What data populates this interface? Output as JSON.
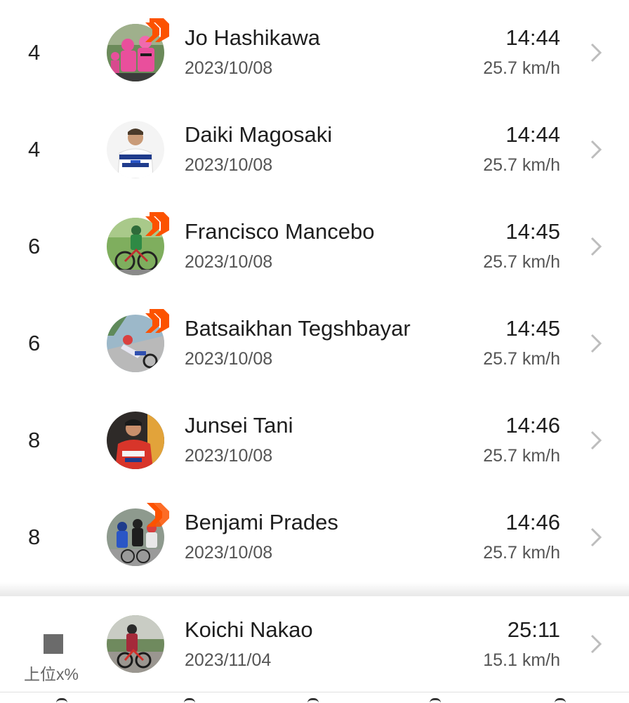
{
  "leaderboard": {
    "rows": [
      {
        "rank": "4",
        "name": "Jo Hashikawa",
        "date": "2023/10/08",
        "time": "14:44",
        "speed": "25.7 km/h",
        "badge": "subscriber-single",
        "avatar": "pink-team-rider"
      },
      {
        "rank": "4",
        "name": "Daiki Magosaki",
        "date": "2023/10/08",
        "time": "14:44",
        "speed": "25.7 km/h",
        "badge": "none",
        "avatar": "white-jersey-portrait"
      },
      {
        "rank": "6",
        "name": "Francisco Mancebo",
        "date": "2023/10/08",
        "time": "14:45",
        "speed": "25.7 km/h",
        "badge": "subscriber-single",
        "avatar": "green-road-rider"
      },
      {
        "rank": "6",
        "name": "Batsaikhan Tegshbayar",
        "date": "2023/10/08",
        "time": "14:45",
        "speed": "25.7 km/h",
        "badge": "subscriber-single",
        "avatar": "rider-in-turn"
      },
      {
        "rank": "8",
        "name": "Junsei Tani",
        "date": "2023/10/08",
        "time": "14:46",
        "speed": "25.7 km/h",
        "badge": "none",
        "avatar": "red-jersey-portrait"
      },
      {
        "rank": "8",
        "name": "Benjami Prades",
        "date": "2023/10/08",
        "time": "14:46",
        "speed": "25.7 km/h",
        "badge": "subscriber-double",
        "avatar": "peloton-group"
      }
    ]
  },
  "current_user": {
    "rank_label": "上位x%",
    "name": "Koichi Nakao",
    "date": "2023/11/04",
    "time": "25:11",
    "speed": "15.1 km/h",
    "avatar": "rider-on-road"
  },
  "colors": {
    "badge_orange": "#fc5200",
    "chevron": "#bdbdbd",
    "text_primary": "#1e1e1e",
    "text_secondary": "#555555"
  }
}
